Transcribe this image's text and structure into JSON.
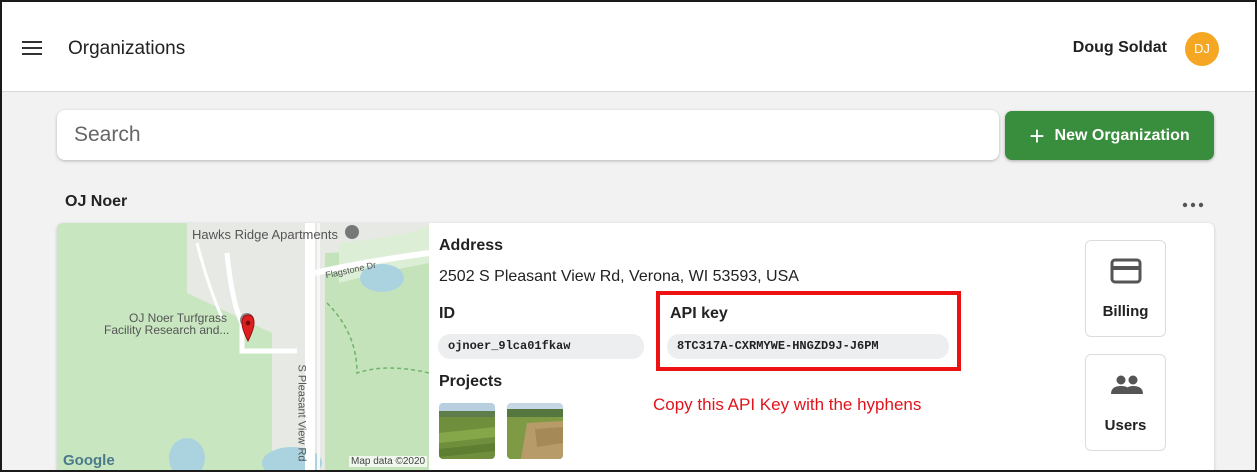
{
  "header": {
    "title": "Organizations",
    "user_name": "Doug Soldat",
    "avatar_initials": "DJ"
  },
  "search": {
    "placeholder": "Search",
    "value": ""
  },
  "new_org_button": {
    "icon": "plus-icon",
    "label": "New Organization"
  },
  "organization": {
    "name": "OJ Noer",
    "map": {
      "labels": [
        "Hawks Ridge Apartments",
        "Flagstone Dr",
        "OJ Noer Turfgrass",
        "Facility Research and...",
        "S Pleasant View Rd"
      ],
      "logo": "Google",
      "attribution": "Map data ©2020"
    },
    "address_label": "Address",
    "address": "2502 S Pleasant View Rd, Verona, WI 53593, USA",
    "id_label": "ID",
    "id_value": "ojnoer_9lca01fkaw",
    "api_key_label": "API key",
    "api_key_value": "8TC317A-CXRMYWE-HNGZD9J-J6PM",
    "projects_label": "Projects",
    "actions": [
      {
        "label": "Billing",
        "icon": "credit-card-icon"
      },
      {
        "label": "Users",
        "icon": "users-icon"
      }
    ]
  },
  "annotation": {
    "text": "Copy this API Key with the hyphens",
    "color": "#e0141b"
  },
  "colors": {
    "primary_green": "#388e3c",
    "avatar": "#f5a623"
  }
}
